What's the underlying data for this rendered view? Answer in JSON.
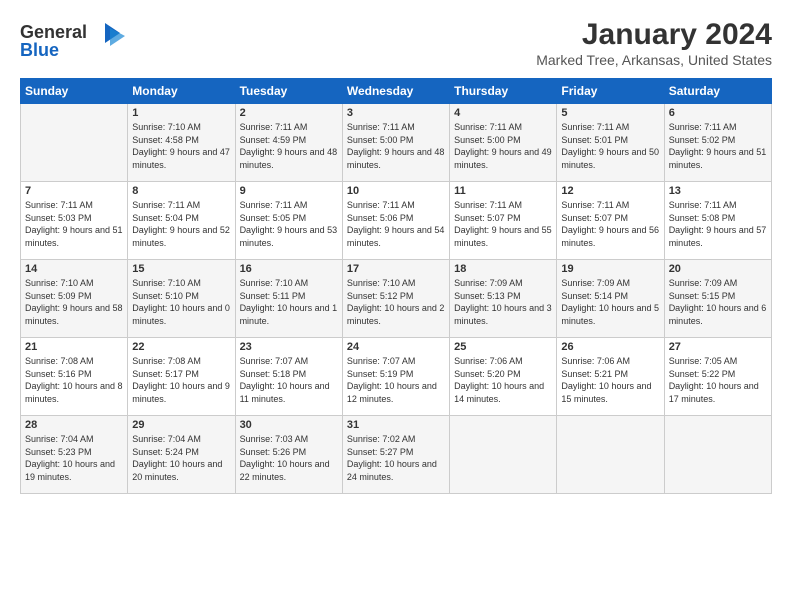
{
  "logo": {
    "line1": "General",
    "line2": "Blue"
  },
  "title": "January 2024",
  "location": "Marked Tree, Arkansas, United States",
  "days_of_week": [
    "Sunday",
    "Monday",
    "Tuesday",
    "Wednesday",
    "Thursday",
    "Friday",
    "Saturday"
  ],
  "weeks": [
    [
      {
        "num": "",
        "sunrise": "",
        "sunset": "",
        "daylight": ""
      },
      {
        "num": "1",
        "sunrise": "7:10 AM",
        "sunset": "4:58 PM",
        "daylight": "9 hours and 47 minutes."
      },
      {
        "num": "2",
        "sunrise": "7:11 AM",
        "sunset": "4:59 PM",
        "daylight": "9 hours and 48 minutes."
      },
      {
        "num": "3",
        "sunrise": "7:11 AM",
        "sunset": "5:00 PM",
        "daylight": "9 hours and 48 minutes."
      },
      {
        "num": "4",
        "sunrise": "7:11 AM",
        "sunset": "5:00 PM",
        "daylight": "9 hours and 49 minutes."
      },
      {
        "num": "5",
        "sunrise": "7:11 AM",
        "sunset": "5:01 PM",
        "daylight": "9 hours and 50 minutes."
      },
      {
        "num": "6",
        "sunrise": "7:11 AM",
        "sunset": "5:02 PM",
        "daylight": "9 hours and 51 minutes."
      }
    ],
    [
      {
        "num": "7",
        "sunrise": "7:11 AM",
        "sunset": "5:03 PM",
        "daylight": "9 hours and 51 minutes."
      },
      {
        "num": "8",
        "sunrise": "7:11 AM",
        "sunset": "5:04 PM",
        "daylight": "9 hours and 52 minutes."
      },
      {
        "num": "9",
        "sunrise": "7:11 AM",
        "sunset": "5:05 PM",
        "daylight": "9 hours and 53 minutes."
      },
      {
        "num": "10",
        "sunrise": "7:11 AM",
        "sunset": "5:06 PM",
        "daylight": "9 hours and 54 minutes."
      },
      {
        "num": "11",
        "sunrise": "7:11 AM",
        "sunset": "5:07 PM",
        "daylight": "9 hours and 55 minutes."
      },
      {
        "num": "12",
        "sunrise": "7:11 AM",
        "sunset": "5:07 PM",
        "daylight": "9 hours and 56 minutes."
      },
      {
        "num": "13",
        "sunrise": "7:11 AM",
        "sunset": "5:08 PM",
        "daylight": "9 hours and 57 minutes."
      }
    ],
    [
      {
        "num": "14",
        "sunrise": "7:10 AM",
        "sunset": "5:09 PM",
        "daylight": "9 hours and 58 minutes."
      },
      {
        "num": "15",
        "sunrise": "7:10 AM",
        "sunset": "5:10 PM",
        "daylight": "10 hours and 0 minutes."
      },
      {
        "num": "16",
        "sunrise": "7:10 AM",
        "sunset": "5:11 PM",
        "daylight": "10 hours and 1 minute."
      },
      {
        "num": "17",
        "sunrise": "7:10 AM",
        "sunset": "5:12 PM",
        "daylight": "10 hours and 2 minutes."
      },
      {
        "num": "18",
        "sunrise": "7:09 AM",
        "sunset": "5:13 PM",
        "daylight": "10 hours and 3 minutes."
      },
      {
        "num": "19",
        "sunrise": "7:09 AM",
        "sunset": "5:14 PM",
        "daylight": "10 hours and 5 minutes."
      },
      {
        "num": "20",
        "sunrise": "7:09 AM",
        "sunset": "5:15 PM",
        "daylight": "10 hours and 6 minutes."
      }
    ],
    [
      {
        "num": "21",
        "sunrise": "7:08 AM",
        "sunset": "5:16 PM",
        "daylight": "10 hours and 8 minutes."
      },
      {
        "num": "22",
        "sunrise": "7:08 AM",
        "sunset": "5:17 PM",
        "daylight": "10 hours and 9 minutes."
      },
      {
        "num": "23",
        "sunrise": "7:07 AM",
        "sunset": "5:18 PM",
        "daylight": "10 hours and 11 minutes."
      },
      {
        "num": "24",
        "sunrise": "7:07 AM",
        "sunset": "5:19 PM",
        "daylight": "10 hours and 12 minutes."
      },
      {
        "num": "25",
        "sunrise": "7:06 AM",
        "sunset": "5:20 PM",
        "daylight": "10 hours and 14 minutes."
      },
      {
        "num": "26",
        "sunrise": "7:06 AM",
        "sunset": "5:21 PM",
        "daylight": "10 hours and 15 minutes."
      },
      {
        "num": "27",
        "sunrise": "7:05 AM",
        "sunset": "5:22 PM",
        "daylight": "10 hours and 17 minutes."
      }
    ],
    [
      {
        "num": "28",
        "sunrise": "7:04 AM",
        "sunset": "5:23 PM",
        "daylight": "10 hours and 19 minutes."
      },
      {
        "num": "29",
        "sunrise": "7:04 AM",
        "sunset": "5:24 PM",
        "daylight": "10 hours and 20 minutes."
      },
      {
        "num": "30",
        "sunrise": "7:03 AM",
        "sunset": "5:26 PM",
        "daylight": "10 hours and 22 minutes."
      },
      {
        "num": "31",
        "sunrise": "7:02 AM",
        "sunset": "5:27 PM",
        "daylight": "10 hours and 24 minutes."
      },
      {
        "num": "",
        "sunrise": "",
        "sunset": "",
        "daylight": ""
      },
      {
        "num": "",
        "sunrise": "",
        "sunset": "",
        "daylight": ""
      },
      {
        "num": "",
        "sunrise": "",
        "sunset": "",
        "daylight": ""
      }
    ]
  ]
}
